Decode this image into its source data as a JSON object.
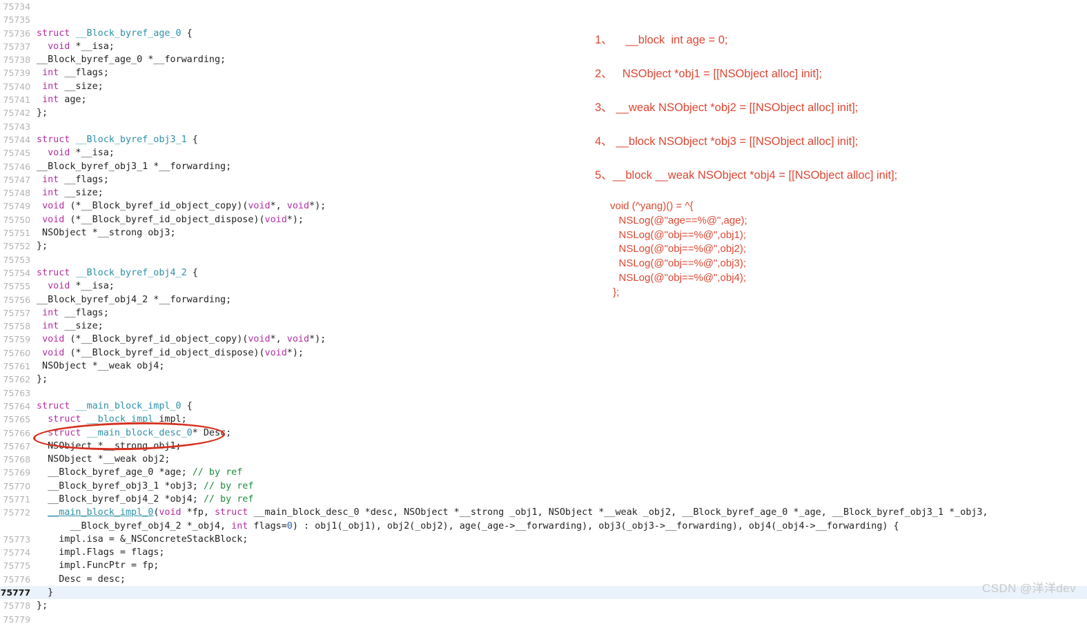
{
  "editor": {
    "first_line_number": 75734,
    "active_line_number": 75777,
    "gutter_color": "#b3b3b3",
    "active_line_bg": "#eaf2fb",
    "syntax_colors": {
      "keyword": "#b32fa0",
      "type": "#2d8fa8",
      "number": "#2a5db0",
      "comment": "#1f8a3c",
      "text": "#222222"
    },
    "lines": [
      {
        "n": 75734,
        "tokens": []
      },
      {
        "n": 75735,
        "tokens": []
      },
      {
        "n": 75736,
        "tokens": [
          {
            "c": "kw",
            "t": "struct"
          },
          {
            "c": "txt",
            "t": " "
          },
          {
            "c": "type",
            "t": "__Block_byref_age_0"
          },
          {
            "c": "txt",
            "t": " {"
          }
        ]
      },
      {
        "n": 75737,
        "tokens": [
          {
            "c": "txt",
            "t": "  "
          },
          {
            "c": "kw",
            "t": "void"
          },
          {
            "c": "txt",
            "t": " *__isa;"
          }
        ]
      },
      {
        "n": 75738,
        "tokens": [
          {
            "c": "txt",
            "t": "__Block_byref_age_0 *__forwarding;"
          }
        ]
      },
      {
        "n": 75739,
        "tokens": [
          {
            "c": "txt",
            "t": " "
          },
          {
            "c": "kw",
            "t": "int"
          },
          {
            "c": "txt",
            "t": " __flags;"
          }
        ]
      },
      {
        "n": 75740,
        "tokens": [
          {
            "c": "txt",
            "t": " "
          },
          {
            "c": "kw",
            "t": "int"
          },
          {
            "c": "txt",
            "t": " __size;"
          }
        ]
      },
      {
        "n": 75741,
        "tokens": [
          {
            "c": "txt",
            "t": " "
          },
          {
            "c": "kw",
            "t": "int"
          },
          {
            "c": "txt",
            "t": " age;"
          }
        ]
      },
      {
        "n": 75742,
        "tokens": [
          {
            "c": "txt",
            "t": "};"
          }
        ]
      },
      {
        "n": 75743,
        "tokens": []
      },
      {
        "n": 75744,
        "tokens": [
          {
            "c": "kw",
            "t": "struct"
          },
          {
            "c": "txt",
            "t": " "
          },
          {
            "c": "type",
            "t": "__Block_byref_obj3_1"
          },
          {
            "c": "txt",
            "t": " {"
          }
        ]
      },
      {
        "n": 75745,
        "tokens": [
          {
            "c": "txt",
            "t": "  "
          },
          {
            "c": "kw",
            "t": "void"
          },
          {
            "c": "txt",
            "t": " *__isa;"
          }
        ]
      },
      {
        "n": 75746,
        "tokens": [
          {
            "c": "txt",
            "t": "__Block_byref_obj3_1 *__forwarding;"
          }
        ]
      },
      {
        "n": 75747,
        "tokens": [
          {
            "c": "txt",
            "t": " "
          },
          {
            "c": "kw",
            "t": "int"
          },
          {
            "c": "txt",
            "t": " __flags;"
          }
        ]
      },
      {
        "n": 75748,
        "tokens": [
          {
            "c": "txt",
            "t": " "
          },
          {
            "c": "kw",
            "t": "int"
          },
          {
            "c": "txt",
            "t": " __size;"
          }
        ]
      },
      {
        "n": 75749,
        "tokens": [
          {
            "c": "txt",
            "t": " "
          },
          {
            "c": "kw",
            "t": "void"
          },
          {
            "c": "txt",
            "t": " (*__Block_byref_id_object_copy)("
          },
          {
            "c": "kw",
            "t": "void"
          },
          {
            "c": "txt",
            "t": "*, "
          },
          {
            "c": "kw",
            "t": "void"
          },
          {
            "c": "txt",
            "t": "*);"
          }
        ]
      },
      {
        "n": 75750,
        "tokens": [
          {
            "c": "txt",
            "t": " "
          },
          {
            "c": "kw",
            "t": "void"
          },
          {
            "c": "txt",
            "t": " (*__Block_byref_id_object_dispose)("
          },
          {
            "c": "kw",
            "t": "void"
          },
          {
            "c": "txt",
            "t": "*);"
          }
        ]
      },
      {
        "n": 75751,
        "tokens": [
          {
            "c": "txt",
            "t": " NSObject *__strong obj3;"
          }
        ]
      },
      {
        "n": 75752,
        "tokens": [
          {
            "c": "txt",
            "t": "};"
          }
        ]
      },
      {
        "n": 75753,
        "tokens": []
      },
      {
        "n": 75754,
        "tokens": [
          {
            "c": "kw",
            "t": "struct"
          },
          {
            "c": "txt",
            "t": " "
          },
          {
            "c": "type",
            "t": "__Block_byref_obj4_2"
          },
          {
            "c": "txt",
            "t": " {"
          }
        ]
      },
      {
        "n": 75755,
        "tokens": [
          {
            "c": "txt",
            "t": "  "
          },
          {
            "c": "kw",
            "t": "void"
          },
          {
            "c": "txt",
            "t": " *__isa;"
          }
        ]
      },
      {
        "n": 75756,
        "tokens": [
          {
            "c": "txt",
            "t": "__Block_byref_obj4_2 *__forwarding;"
          }
        ]
      },
      {
        "n": 75757,
        "tokens": [
          {
            "c": "txt",
            "t": " "
          },
          {
            "c": "kw",
            "t": "int"
          },
          {
            "c": "txt",
            "t": " __flags;"
          }
        ]
      },
      {
        "n": 75758,
        "tokens": [
          {
            "c": "txt",
            "t": " "
          },
          {
            "c": "kw",
            "t": "int"
          },
          {
            "c": "txt",
            "t": " __size;"
          }
        ]
      },
      {
        "n": 75759,
        "tokens": [
          {
            "c": "txt",
            "t": " "
          },
          {
            "c": "kw",
            "t": "void"
          },
          {
            "c": "txt",
            "t": " (*__Block_byref_id_object_copy)("
          },
          {
            "c": "kw",
            "t": "void"
          },
          {
            "c": "txt",
            "t": "*, "
          },
          {
            "c": "kw",
            "t": "void"
          },
          {
            "c": "txt",
            "t": "*);"
          }
        ]
      },
      {
        "n": 75760,
        "tokens": [
          {
            "c": "txt",
            "t": " "
          },
          {
            "c": "kw",
            "t": "void"
          },
          {
            "c": "txt",
            "t": " (*__Block_byref_id_object_dispose)("
          },
          {
            "c": "kw",
            "t": "void"
          },
          {
            "c": "txt",
            "t": "*);"
          }
        ]
      },
      {
        "n": 75761,
        "tokens": [
          {
            "c": "txt",
            "t": " NSObject *__weak obj4;"
          }
        ]
      },
      {
        "n": 75762,
        "tokens": [
          {
            "c": "txt",
            "t": "};"
          }
        ]
      },
      {
        "n": 75763,
        "tokens": []
      },
      {
        "n": 75764,
        "tokens": [
          {
            "c": "kw",
            "t": "struct"
          },
          {
            "c": "txt",
            "t": " "
          },
          {
            "c": "type",
            "t": "__main_block_impl_0"
          },
          {
            "c": "txt",
            "t": " {"
          }
        ]
      },
      {
        "n": 75765,
        "tokens": [
          {
            "c": "txt",
            "t": "  "
          },
          {
            "c": "kw",
            "t": "struct"
          },
          {
            "c": "txt",
            "t": " "
          },
          {
            "c": "type",
            "t": "__block_impl"
          },
          {
            "c": "txt",
            "t": " impl;"
          }
        ]
      },
      {
        "n": 75766,
        "tokens": [
          {
            "c": "txt",
            "t": "  "
          },
          {
            "c": "kw",
            "t": "struct"
          },
          {
            "c": "txt",
            "t": " "
          },
          {
            "c": "type",
            "t": "__main_block_desc_0"
          },
          {
            "c": "txt",
            "t": "* Desc;"
          }
        ]
      },
      {
        "n": 75767,
        "tokens": [
          {
            "c": "txt",
            "t": "  NSObject *__strong obj1;"
          }
        ]
      },
      {
        "n": 75768,
        "tokens": [
          {
            "c": "txt",
            "t": "  NSObject *__weak obj2;"
          }
        ]
      },
      {
        "n": 75769,
        "tokens": [
          {
            "c": "txt",
            "t": "  __Block_byref_age_0 *age; "
          },
          {
            "c": "cmt",
            "t": "// by ref"
          }
        ]
      },
      {
        "n": 75770,
        "tokens": [
          {
            "c": "txt",
            "t": "  __Block_byref_obj3_1 *obj3; "
          },
          {
            "c": "cmt",
            "t": "// by ref"
          }
        ]
      },
      {
        "n": 75771,
        "tokens": [
          {
            "c": "txt",
            "t": "  __Block_byref_obj4_2 *obj4; "
          },
          {
            "c": "cmt",
            "t": "// by ref"
          }
        ]
      },
      {
        "n": 75772,
        "tokens": [
          {
            "c": "txt",
            "t": "  "
          },
          {
            "c": "fn",
            "t": "__main_block_impl_0"
          },
          {
            "c": "txt",
            "t": "("
          },
          {
            "c": "kw",
            "t": "void"
          },
          {
            "c": "txt",
            "t": " *fp, "
          },
          {
            "c": "kw",
            "t": "struct"
          },
          {
            "c": "txt",
            "t": " __main_block_desc_0 *desc, NSObject *__strong _obj1, NSObject *__weak _obj2, __Block_byref_age_0 *_age, __Block_byref_obj3_1 *_obj3,"
          }
        ]
      },
      {
        "n": null,
        "tokens": [
          {
            "c": "txt",
            "t": "      __Block_byref_obj4_2 *_obj4, "
          },
          {
            "c": "kw",
            "t": "int"
          },
          {
            "c": "txt",
            "t": " flags="
          },
          {
            "c": "num",
            "t": "0"
          },
          {
            "c": "txt",
            "t": ") : obj1(_obj1), obj2(_obj2), age(_age->__forwarding), obj3(_obj3->__forwarding), obj4(_obj4->__forwarding) {"
          }
        ]
      },
      {
        "n": 75773,
        "tokens": [
          {
            "c": "txt",
            "t": "    impl.isa = &_NSConcreteStackBlock;"
          }
        ]
      },
      {
        "n": 75774,
        "tokens": [
          {
            "c": "txt",
            "t": "    impl.Flags = flags;"
          }
        ]
      },
      {
        "n": 75775,
        "tokens": [
          {
            "c": "txt",
            "t": "    impl.FuncPtr = fp;"
          }
        ]
      },
      {
        "n": 75776,
        "tokens": [
          {
            "c": "txt",
            "t": "    Desc = desc;"
          }
        ]
      },
      {
        "n": 75777,
        "tokens": [
          {
            "c": "txt",
            "t": "  }"
          }
        ],
        "active": true
      },
      {
        "n": 75778,
        "tokens": [
          {
            "c": "txt",
            "t": "};"
          }
        ]
      },
      {
        "n": 75779,
        "tokens": []
      }
    ]
  },
  "annotation": {
    "ellipse_color": "#d6301f",
    "ellipse_targets": "NSObject *__strong obj1; / NSObject *__weak obj2;"
  },
  "notes": {
    "color": "#dd4632",
    "items": [
      {
        "num": "1、",
        "text": "    __block  int age = 0;"
      },
      {
        "num": "2、",
        "text": "   NSObject *obj1 = [[NSObject alloc] init];"
      },
      {
        "num": "3、",
        "text": " __weak NSObject *obj2 = [[NSObject alloc] init];"
      },
      {
        "num": "4、",
        "text": " __block NSObject *obj3 = [[NSObject alloc] init];"
      },
      {
        "num": "5、",
        "text": "__block __weak NSObject *obj4 = [[NSObject alloc] init];"
      }
    ],
    "block_code": "void (^yang)() = ^{\n   NSLog(@\"age==%@\",age);\n   NSLog(@\"obj==%@\",obj1);\n   NSLog(@\"obj==%@\",obj2);\n   NSLog(@\"obj==%@\",obj3);\n   NSLog(@\"obj==%@\",obj4);\n };"
  },
  "watermark": {
    "text": "CSDN @洋洋dev"
  }
}
